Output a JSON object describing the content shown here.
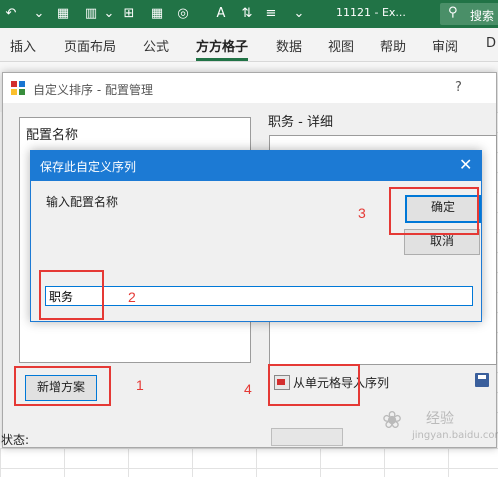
{
  "excel": {
    "title": "11121 - Ex...",
    "search_label": "搜索",
    "tabs": [
      "插入",
      "页面布局",
      "公式",
      "方方格子",
      "数据",
      "视图",
      "帮助",
      "审阅",
      "D"
    ],
    "active_tab": "方方格子",
    "brand_color": "#217346"
  },
  "outer_dialog": {
    "title": "自定义排序 - 配置管理",
    "help": "?",
    "left_label": "配置名称",
    "right_label": "职务 - 详细",
    "new_button": "新增方案",
    "import_button": "从单元格导入序列",
    "status_label": "状态:"
  },
  "inner_dialog": {
    "title": "保存此自定义序列",
    "close": "✕",
    "prompt": "输入配置名称",
    "ok_button": "确定",
    "cancel_button": "取消",
    "input_value": "职务",
    "title_color": "#1c7ad4"
  },
  "annotations": {
    "numbers": [
      "1",
      "2",
      "3",
      "4"
    ],
    "color": "#e53935"
  },
  "watermark": {
    "line1": "经验",
    "line2": "jingyan.baidu.com"
  }
}
